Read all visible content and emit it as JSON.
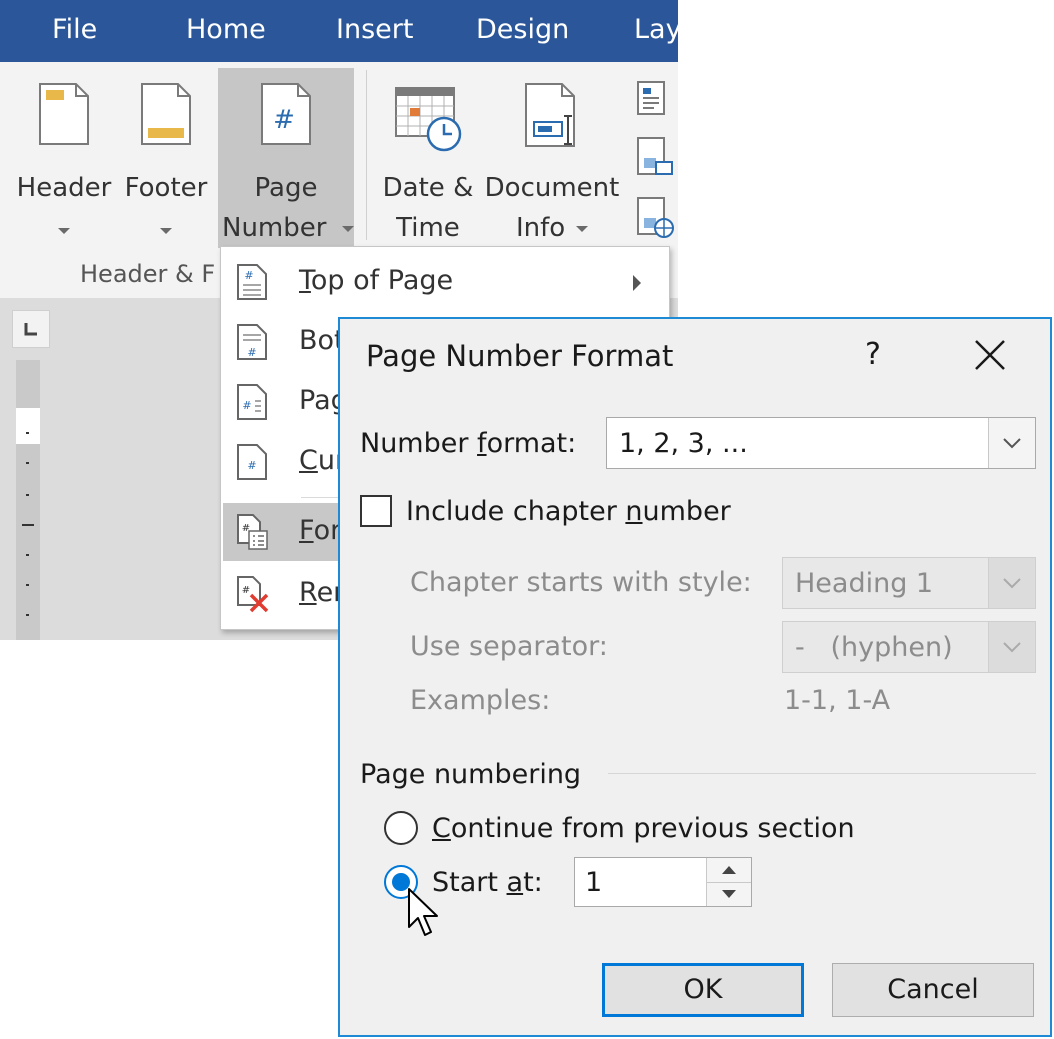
{
  "ribbon": {
    "tabs": [
      "File",
      "Home",
      "Insert",
      "Design",
      "Lay"
    ],
    "buttons": {
      "header": "Header",
      "footer": "Footer",
      "page_number_line1": "Page",
      "page_number_line2": "Number",
      "date_time_line1": "Date &",
      "date_time_line2": "Time",
      "document_info_line1": "Document",
      "document_info_line2": "Info"
    },
    "group_label": "Header & F"
  },
  "menu": {
    "items": [
      {
        "label": "Top of Page",
        "accel": "T",
        "rest": "op of Page",
        "has_submenu": true
      },
      {
        "label": "Bot",
        "accel": "",
        "rest": "Bot"
      },
      {
        "label": "Pag",
        "accel": "",
        "rest": "Pag"
      },
      {
        "label": "Cur",
        "accel": "C",
        "rest": "ur"
      },
      {
        "label": "For",
        "accel": "F",
        "rest": "or",
        "highlighted": true
      },
      {
        "label": "Rer",
        "accel": "R",
        "rest": "er"
      }
    ]
  },
  "dialog": {
    "title": "Page Number Format",
    "help": "?",
    "number_format": {
      "label_pre": "Number ",
      "label_accel": "f",
      "label_post": "ormat:",
      "value": "1, 2, 3, ..."
    },
    "include_chapter": {
      "label_pre": "Include chapter ",
      "label_accel": "n",
      "label_post": "umber",
      "checked": false
    },
    "chapter_style": {
      "label": "Chapter starts with style:",
      "value": "Heading 1"
    },
    "separator": {
      "label": "Use separator:",
      "value": "-   (hyphen)"
    },
    "examples": {
      "label": "Examples:",
      "value": "1-1, 1-A"
    },
    "page_numbering": {
      "group_label": "Page numbering",
      "continue": {
        "label_accel": "C",
        "label_post": "ontinue from previous section",
        "selected": false
      },
      "start_at": {
        "label_pre": "Start ",
        "label_accel": "a",
        "label_post": "t:",
        "selected": true,
        "value": "1"
      }
    },
    "buttons": {
      "ok": "OK",
      "cancel": "Cancel"
    }
  },
  "colors": {
    "tab_bar": "#2b579a",
    "dialog_border": "#1e8ad6",
    "accent": "#0078d7"
  }
}
